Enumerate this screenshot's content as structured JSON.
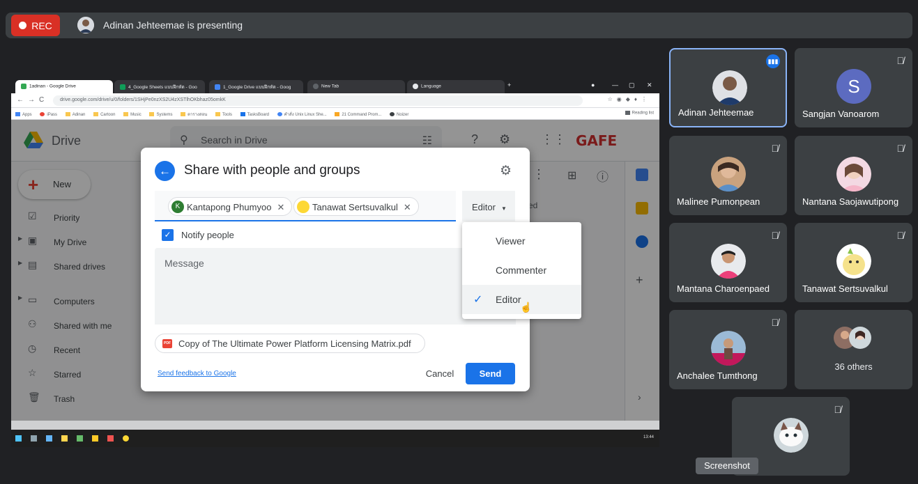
{
  "meet": {
    "rec_label": "REC",
    "presenting_text": "Adinan Jehteemae is presenting",
    "tooltip": "Screenshot"
  },
  "browser": {
    "tabs": [
      {
        "label": "1adinan - Google Drive"
      },
      {
        "label": "4_Google Sheets แบบฝึกหัด - Goo"
      },
      {
        "label": "1_Google Drive แบบฝึกหัด - Goog"
      },
      {
        "label": "New Tab"
      },
      {
        "label": "Language"
      }
    ],
    "url": "drive.google.com/drive/u/0/folders/1SHjPe0nzXS2U4zXSTlhOKbhaz05omkK",
    "bookmarks": [
      "Apps",
      "iPass",
      "Adinan",
      "Cartoon",
      "Music",
      "Systems",
      "ตารางสอน",
      "Tools",
      "TasksBoard",
      "คำสั่ง Unix Linux She...",
      "21 Command Prom...",
      "Noizer"
    ],
    "reading_list": "Reading list",
    "taskbar_time": "13:44"
  },
  "drive": {
    "title": "Drive",
    "search_placeholder": "Search in Drive",
    "new_label": "New",
    "brand": "GAFE",
    "nav": [
      {
        "label": "Priority",
        "icon": "priority-icon"
      },
      {
        "label": "My Drive",
        "icon": "my-drive-icon"
      },
      {
        "label": "Shared drives",
        "icon": "shared-drives-icon"
      },
      {
        "label": "Computers",
        "icon": "computers-icon"
      },
      {
        "label": "Shared with me",
        "icon": "shared-with-me-icon"
      },
      {
        "label": "Recent",
        "icon": "recent-icon"
      },
      {
        "label": "Starred",
        "icon": "starred-icon"
      },
      {
        "label": "Trash",
        "icon": "trash-icon"
      }
    ],
    "partial_text": "ed"
  },
  "share_dialog": {
    "title": "Share with people and groups",
    "chips": [
      {
        "initial": "K",
        "name": "Kantapong Phumyoo",
        "color": "#2e7d32"
      },
      {
        "initial": "",
        "name": "Tanawat Sertsuvalkul",
        "color": "#f9a825"
      }
    ],
    "role": "Editor",
    "notify_label": "Notify people",
    "notify_checked": true,
    "message_placeholder": "Message",
    "attachment": "Copy of The Ultimate Power Platform Licensing Matrix.pdf",
    "pdf_badge": "PDF",
    "feedback_link": "Send feedback to Google",
    "cancel_label": "Cancel",
    "send_label": "Send"
  },
  "role_menu": {
    "items": [
      {
        "label": "Viewer"
      },
      {
        "label": "Commenter"
      },
      {
        "label": "Editor"
      }
    ],
    "selected": "Editor"
  },
  "participants": [
    {
      "name": "Adinan Jehteemae",
      "speaking": true
    },
    {
      "name": "Sangjan Vanoarom",
      "initial": "S",
      "muted": true
    },
    {
      "name": "Malinee Pumonpean",
      "muted": true
    },
    {
      "name": "Nantana Saojawutipong",
      "muted": true
    },
    {
      "name": "Mantana Charoenpaed",
      "muted": true
    },
    {
      "name": "Tanawat Sertsuvalkul",
      "muted": true
    },
    {
      "name": "Anchalee Tumthong",
      "muted": true
    },
    {
      "others": "36 others"
    },
    {
      "name": "",
      "muted": true
    }
  ],
  "colors": {
    "meet_bg": "#202124",
    "tile_bg": "#3c4043",
    "accent_blue": "#1a73e8",
    "rec_red": "#d93025"
  }
}
